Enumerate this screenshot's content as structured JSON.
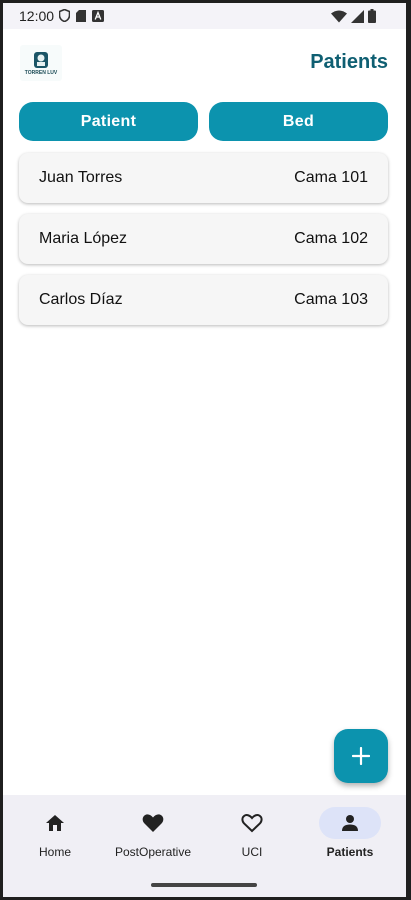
{
  "status_bar": {
    "time": "12:00",
    "left_icons": [
      "shield-icon",
      "sim-card-icon",
      "keyboard-a-icon"
    ],
    "right_icons": [
      "wifi-icon",
      "signal-icon",
      "battery-icon"
    ]
  },
  "header": {
    "logo_text": "TORREN LUV",
    "title": "Patients"
  },
  "filters": {
    "patient_label": "Patient",
    "bed_label": "Bed"
  },
  "patients": [
    {
      "name": "Juan Torres",
      "bed": "Cama 101"
    },
    {
      "name": "Maria López",
      "bed": "Cama 102"
    },
    {
      "name": "Carlos Díaz",
      "bed": "Cama 103"
    }
  ],
  "fab": {
    "icon": "plus-icon"
  },
  "bottom_nav": {
    "items": [
      {
        "label": "Home",
        "icon": "home-icon"
      },
      {
        "label": "PostOperative",
        "icon": "heart-filled-icon"
      },
      {
        "label": "UCI",
        "icon": "heart-outline-icon"
      },
      {
        "label": "Patients",
        "icon": "person-icon"
      }
    ],
    "active": "Patients"
  },
  "colors": {
    "accent": "#0c93ae",
    "title": "#0f5f72",
    "card_bg": "#f6f6f6",
    "nav_bg": "#f0eff5",
    "nav_active_pill": "#dde3f8"
  }
}
